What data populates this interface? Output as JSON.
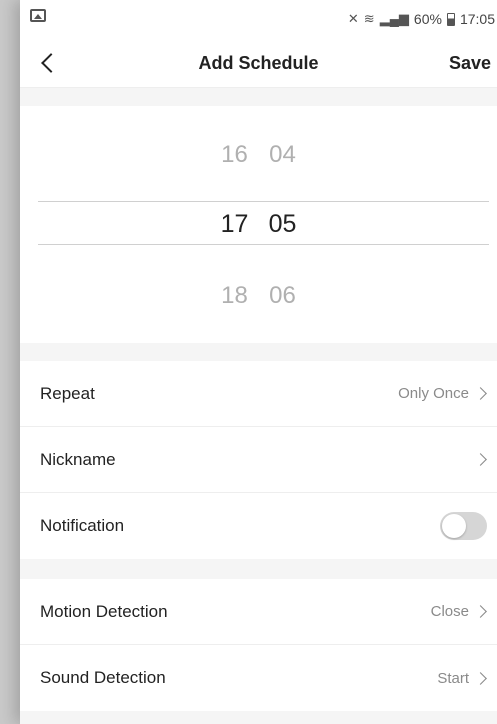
{
  "status_bar": {
    "icons": [
      "image-icon",
      "mute-icon",
      "wifi-icon",
      "signal-icon",
      "battery-icon"
    ],
    "battery": "60%",
    "time": "17:05"
  },
  "nav": {
    "title": "Add Schedule",
    "save_label": "Save"
  },
  "picker": {
    "prev": {
      "hour": "16",
      "minute": "04"
    },
    "current": {
      "hour": "17",
      "minute": "05"
    },
    "next": {
      "hour": "18",
      "minute": "06"
    }
  },
  "settings": {
    "repeat": {
      "label": "Repeat",
      "value": "Only Once"
    },
    "nickname": {
      "label": "Nickname",
      "value": ""
    },
    "notification": {
      "label": "Notification",
      "enabled": false
    },
    "motion": {
      "label": "Motion Detection",
      "value": "Close"
    },
    "sound": {
      "label": "Sound Detection",
      "value": "Start"
    }
  },
  "colors": {
    "background": "#f5f5f5",
    "toggle_off": "#d6d6d6"
  }
}
